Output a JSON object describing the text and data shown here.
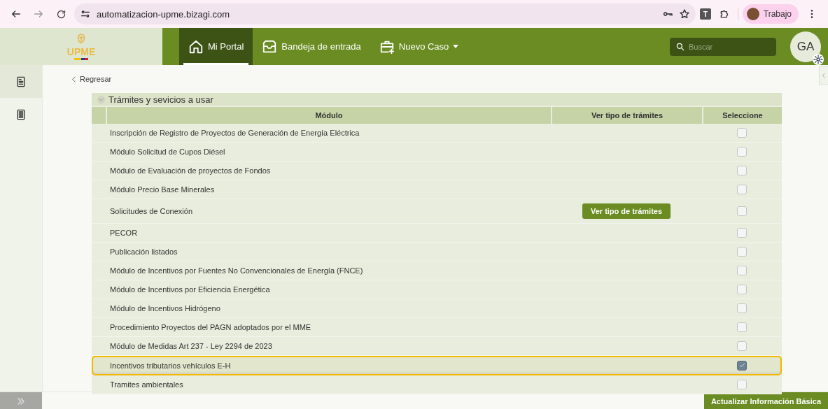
{
  "browser": {
    "url": "automatizacion-upme.bizagi.com",
    "extension_label": "T",
    "profile": "Trabajo"
  },
  "header": {
    "logo": "UPME",
    "nav": [
      {
        "label": "Mi Portal",
        "selected": true,
        "dropdown": false
      },
      {
        "label": "Bandeja de entrada",
        "selected": false,
        "dropdown": false
      },
      {
        "label": "Nuevo Caso",
        "selected": false,
        "dropdown": true
      }
    ],
    "search": {
      "placeholder": "Buscar"
    },
    "avatar": "GA"
  },
  "sidebar": {
    "items": [
      {
        "selected": true
      },
      {
        "selected": false
      }
    ]
  },
  "back": "Regresar",
  "section": {
    "title": "Trámites y sevicios a usar",
    "expanded": true
  },
  "table": {
    "columns": [
      "Módulo",
      "Ver tipo de trámites",
      "Seleccione"
    ],
    "rows": [
      {
        "module": "Inscripción de Registro de Proyectos de Generación de Energía Eléctrica",
        "checked": false,
        "selected": false
      },
      {
        "module": "Módulo Solicitud de Cupos Diésel",
        "checked": false,
        "selected": false
      },
      {
        "module": "Módulo de Evaluación de proyectos de Fondos",
        "checked": false,
        "selected": false
      },
      {
        "module": "Módulo Precio Base Minerales",
        "checked": false,
        "selected": false
      },
      {
        "module": "Solicitudes de Conexión",
        "action": "Ver tipo de trámites",
        "checked": false,
        "selected": false
      },
      {
        "module": "PECOR",
        "checked": false,
        "selected": false
      },
      {
        "module": "Publicación listados",
        "checked": false,
        "selected": false
      },
      {
        "module": "Módulo de Incentivos por Fuentes No Convencionales de Energía (FNCE)",
        "checked": false,
        "selected": false
      },
      {
        "module": "Módulo de Incentivos por Eficiencia Energética",
        "checked": false,
        "selected": false
      },
      {
        "module": "Módulo de Incentivos Hidrógeno",
        "checked": false,
        "selected": false
      },
      {
        "module": "Procedimiento Proyectos del PAGN adoptados por el MME",
        "checked": false,
        "selected": false
      },
      {
        "module": "Módulo de Medidas Art 237 - Ley 2294 de 2023",
        "checked": false,
        "selected": false
      },
      {
        "module": "Incentivos tributarios vehículos E-H",
        "checked": true,
        "selected": true
      },
      {
        "module": "Tramites ambientales",
        "checked": false,
        "selected": false
      }
    ]
  },
  "footer": {
    "button": "Actualizar Información Básica"
  }
}
